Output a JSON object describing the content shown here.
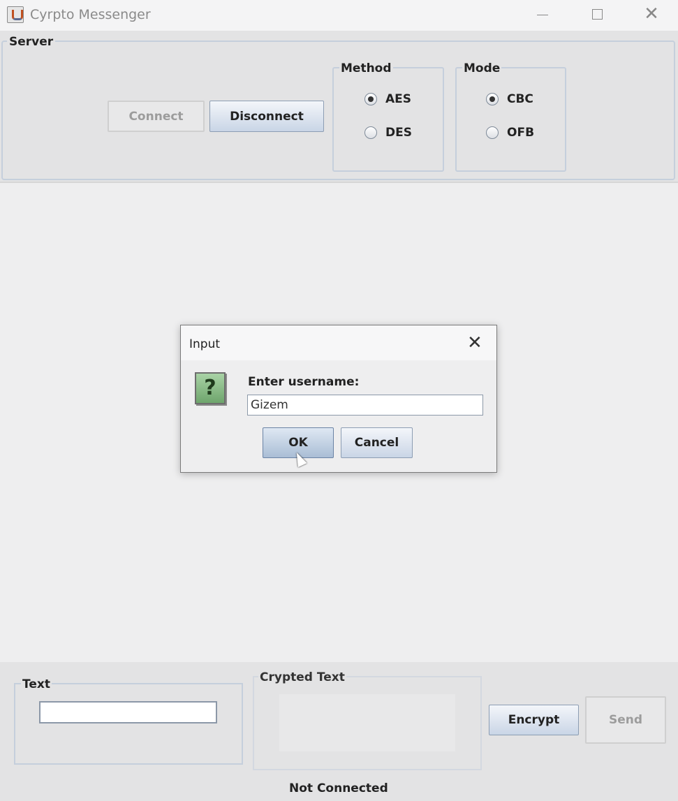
{
  "window": {
    "title": "Cyrpto Messenger",
    "minimize": "–",
    "maximize": "□",
    "close": "✕"
  },
  "server": {
    "label": "Server",
    "connect_label": "Connect",
    "disconnect_label": "Disconnect",
    "method": {
      "label": "Method",
      "options": [
        "AES",
        "DES"
      ],
      "selected": "AES"
    },
    "mode": {
      "label": "Mode",
      "options": [
        "CBC",
        "OFB"
      ],
      "selected": "CBC"
    }
  },
  "dialog": {
    "title": "Input",
    "close": "✕",
    "icon": "?",
    "prompt": "Enter username:",
    "input_value": "Gizem",
    "ok_label": "OK",
    "cancel_label": "Cancel"
  },
  "bottom": {
    "text_label": "Text",
    "crypted_label": "Crypted Text",
    "encrypt_label": "Encrypt",
    "send_label": "Send",
    "status": "Not Connected"
  }
}
